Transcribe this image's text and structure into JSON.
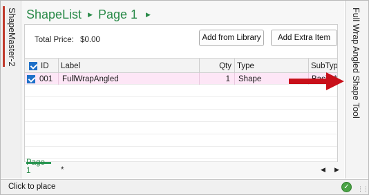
{
  "left_tab": {
    "label": "ShapeMaster-2"
  },
  "right_tab": {
    "label": "Full Wrap Angled Shape Tool"
  },
  "breadcrumb": {
    "root": "ShapeList",
    "page": "Page 1"
  },
  "summary": {
    "total_label": "Total Price:",
    "total_value": "$0.00"
  },
  "buttons": {
    "add_from_library": "Add from Library",
    "add_extra_item": "Add Extra Item"
  },
  "grid": {
    "columns": {
      "id": "ID",
      "label": "Label",
      "qty": "Qty",
      "type": "Type",
      "subtype": "SubType"
    },
    "rows": [
      {
        "checked": true,
        "id": "001",
        "label": "FullWrapAngled",
        "qty": "1",
        "type": "Shape",
        "subtype": "Basic Angl"
      }
    ]
  },
  "bottom_tabs": {
    "page": "Page 1",
    "new_tab": "*"
  },
  "status": {
    "text": "Click to place"
  },
  "colors": {
    "accent_green": "#2a8a49",
    "selection_pink": "#fde6f6",
    "arrow_red": "#c8101a",
    "checkbox_blue": "#1e70c8"
  }
}
